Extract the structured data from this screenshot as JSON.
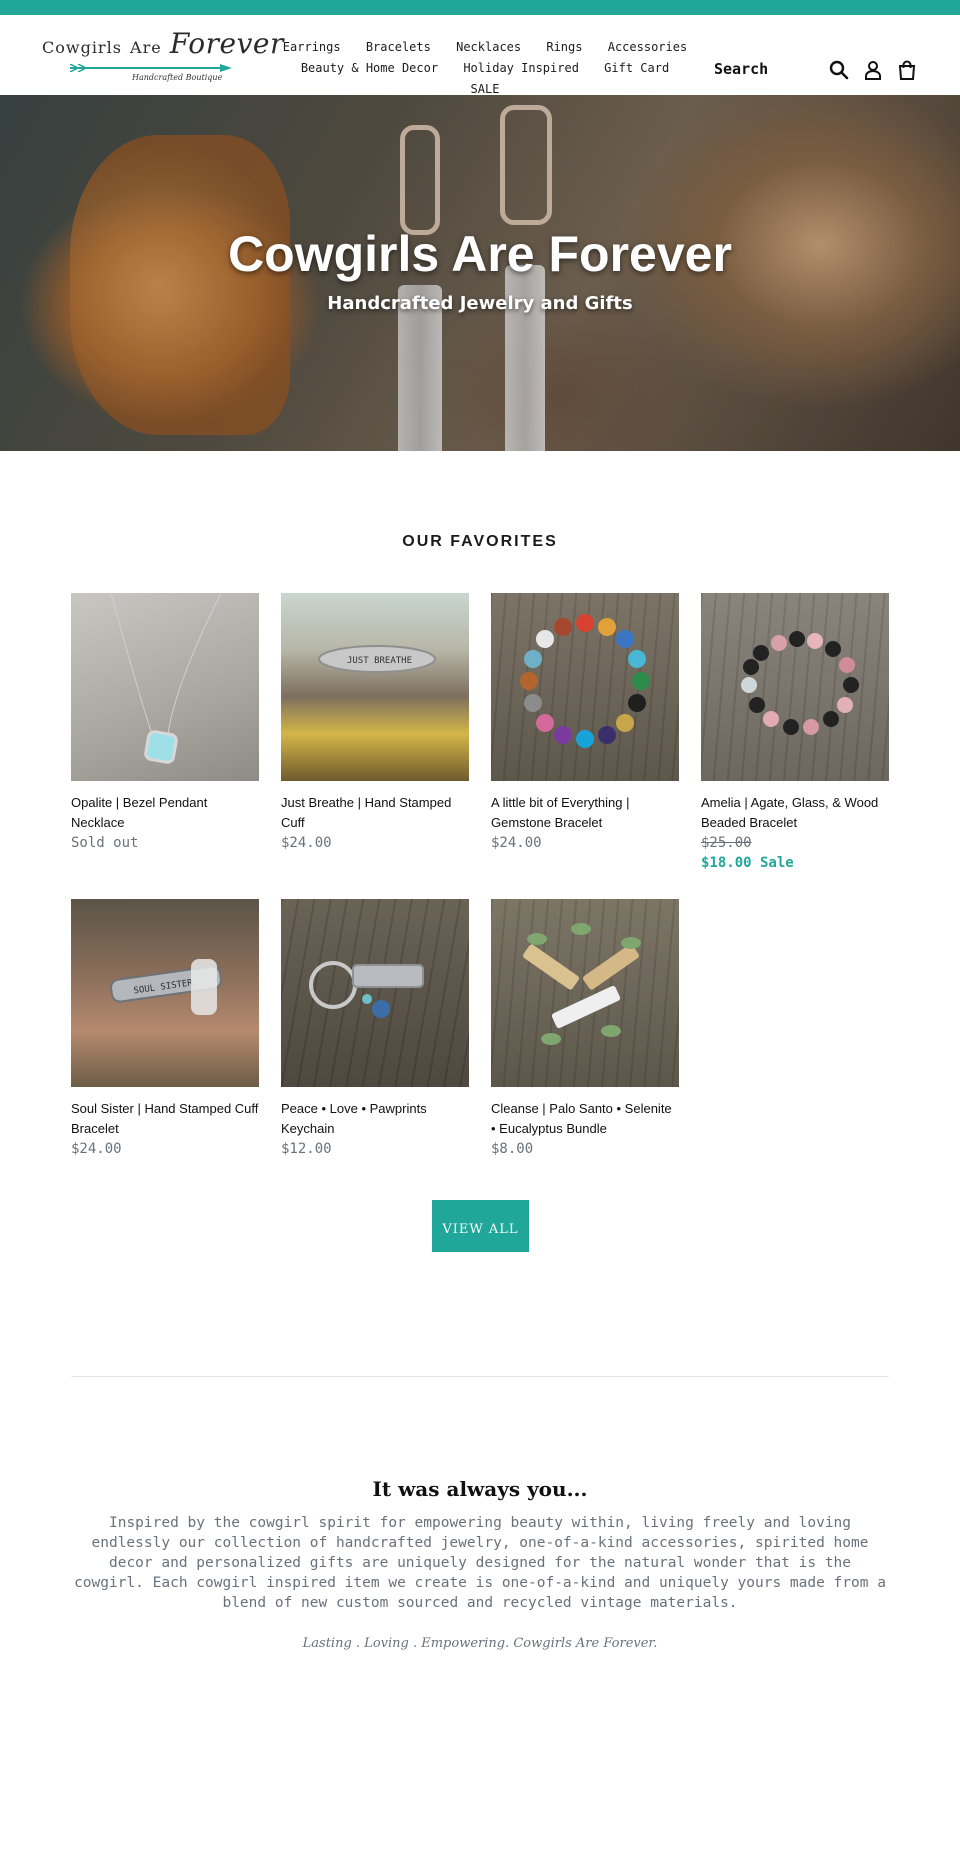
{
  "header": {
    "logo": {
      "word1": "Cowgirls",
      "word2": "Are",
      "word3": "Forever",
      "tagline": "Handcrafted Boutique"
    },
    "nav_row1": [
      "Earrings",
      "Bracelets",
      "Necklaces",
      "Rings",
      "Accessories"
    ],
    "nav_row2": [
      "Beauty & Home Decor",
      "Holiday Inspired",
      "Gift Card",
      "SALE"
    ],
    "search_label": "Search",
    "icons": [
      "search-icon",
      "account-icon",
      "cart-icon"
    ]
  },
  "hero": {
    "title": "Cowgirls Are Forever",
    "subtitle": "Handcrafted Jewelry and Gifts"
  },
  "favorites": {
    "title": "OUR FAVORITES",
    "products": [
      {
        "name": "Opalite | Bezel Pendant Necklace",
        "price": "Sold out"
      },
      {
        "name": "Just Breathe | Hand Stamped Cuff",
        "price": "$24.00"
      },
      {
        "name": "A little bit of Everything | Gemstone Bracelet",
        "price": "$24.00"
      },
      {
        "name": "Amelia | Agate, Glass, & Wood Beaded Bracelet",
        "price": "$25.00",
        "sale_price": "$18.00 Sale"
      },
      {
        "name": "Soul Sister | Hand Stamped Cuff Bracelet",
        "price": "$24.00"
      },
      {
        "name": "Peace • Love • Pawprints Keychain",
        "price": "$12.00"
      },
      {
        "name": "Cleanse | Palo Santo • Selenite • Eucalyptus Bundle",
        "price": "$8.00"
      }
    ],
    "view_all": "VIEW ALL"
  },
  "about": {
    "title": "It was always you...",
    "body": "Inspired by the cowgirl spirit for empowering beauty within, living freely and loving endlessly our collection of handcrafted jewelry, one-of-a-kind accessories, spirited home decor and personalized gifts are uniquely designed for the natural wonder that is the cowgirl. Each cowgirl inspired item we create is one-of-a-kind and uniquely yours made from a blend of new custom sourced and recycled vintage materials.",
    "tagline": "Lasting . Loving . Empowering. Cowgirls Are Forever."
  },
  "colors": {
    "accent": "#21a79a",
    "price_gray": "#69727b"
  }
}
